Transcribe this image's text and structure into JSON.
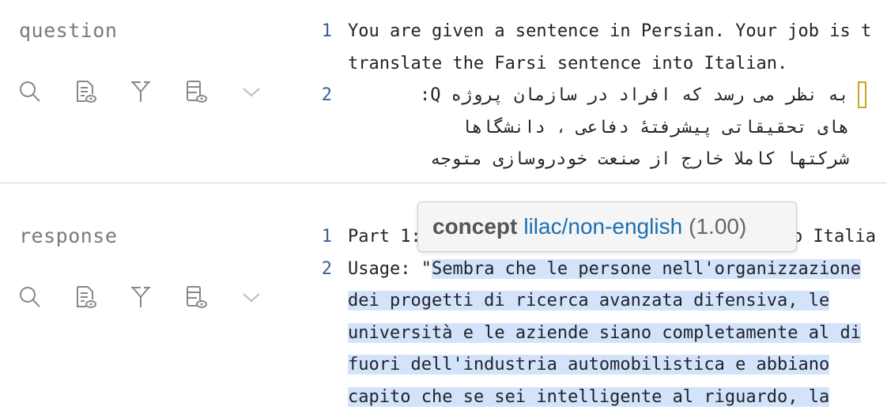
{
  "question": {
    "label": "question",
    "lines": [
      {
        "num": "1",
        "text": "You are given a sentence in Persian. Your job is t"
      },
      {
        "num": "",
        "text": "translate the Farsi sentence into Italian."
      },
      {
        "num": "2",
        "text": "به نظر می رسد که افراد در سازمان پروژه Q:"
      },
      {
        "num": "",
        "text": "های تحقیقاتی پیشرفتهٔ دفاعی ، دانشگاها"
      },
      {
        "num": "",
        "text": "شرکتها کاملا خارج از صنعت خودروسازی متوجه"
      }
    ]
  },
  "response": {
    "label": "response",
    "lines": [
      {
        "num": "1",
        "text": "Part 1:",
        "tail": "o Italia"
      },
      {
        "num": "2",
        "prefix": "Usage: \"",
        "text": "Sembra che le persone nell'organizzazione"
      },
      {
        "num": "",
        "text": "dei progetti di ricerca avanzata difensiva, le"
      },
      {
        "num": "",
        "text": "università e le aziende siano completamente al di"
      },
      {
        "num": "",
        "text": "fuori dell'industria automobilistica e abbiano"
      },
      {
        "num": "",
        "text": "capito che se sei intelligente al riguardo, la"
      }
    ]
  },
  "toolbar": [
    "search-icon",
    "document-preview-icon",
    "fork-icon",
    "database-preview-icon",
    "chevron-down-icon"
  ],
  "tooltip": {
    "key": "concept",
    "value": "lilac/non-english",
    "score": "(1.00)"
  },
  "colors": {
    "label": "#7a7a7a",
    "line_number": "#3a5f95",
    "highlight": "#d3e3fb",
    "tooltip_link": "#1a6fb5",
    "cursor": "#c9a227"
  }
}
